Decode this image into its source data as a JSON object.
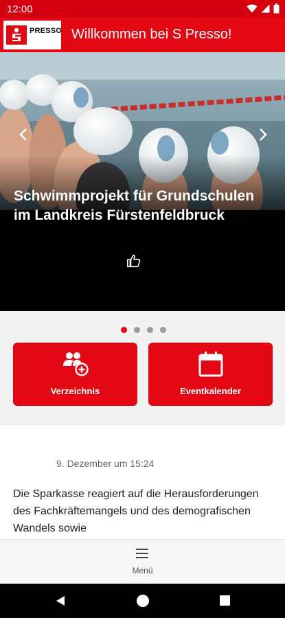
{
  "status_bar": {
    "time": "12:00",
    "icons": [
      "wifi-icon",
      "cellular-signal-icon",
      "battery-icon"
    ]
  },
  "app_bar": {
    "logo_text": "PRESSO",
    "title": "Willkommen bei S Presso!"
  },
  "carousel": {
    "title": "Schwimmprojekt für Grundschulen im Landkreis Fürstenfeldbruck",
    "slide_count": 4,
    "active_index": 0,
    "icons": [
      "chevron-left-icon",
      "chevron-right-icon",
      "thumbs-up-icon"
    ]
  },
  "tiles": [
    {
      "label": "Verzeichnis",
      "icon": "user-group-add-icon"
    },
    {
      "label": "Eventkalender",
      "icon": "calendar-icon"
    }
  ],
  "post": {
    "date": "9. Dezember um 15:24",
    "text": "Die Sparkasse reagiert auf die Herausforderungen des Fachkräftemangels und des demografischen Wandels sowie"
  },
  "bottom_nav": {
    "menu_label": "Menü",
    "icon": "hamburger-menu-icon"
  },
  "colors": {
    "brand_red": "#e30613",
    "status_bar_red": "#d4000f"
  }
}
